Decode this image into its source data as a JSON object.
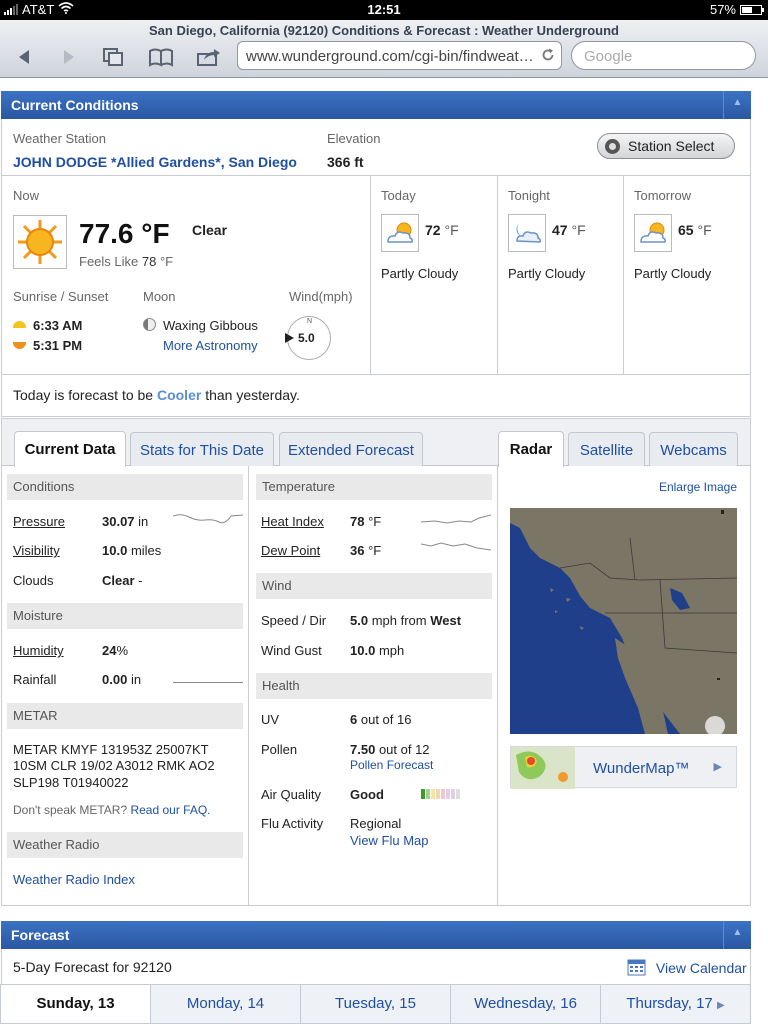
{
  "status": {
    "carrier": "AT&T",
    "time": "12:51",
    "battery": "57%"
  },
  "browser": {
    "title": "San Diego, California (92120) Conditions & Forecast : Weather Underground",
    "url": "www.wunderground.com/cgi-bin/findweat…",
    "search_placeholder": "Google"
  },
  "current": {
    "header": "Current Conditions",
    "station_label": "Weather Station",
    "station_name": "JOHN DODGE *Allied Gardens*, San Diego",
    "elevation_label": "Elevation",
    "elevation": "366 ft",
    "station_select": "Station Select",
    "now_label": "Now",
    "temp": "77.6 °F",
    "condition": "Clear",
    "feels_like_label": "Feels Like",
    "feels_like_value": "78",
    "feels_like_unit": "°F",
    "sun_label": "Sunrise / Sunset",
    "sunrise": "6:33 AM",
    "sunset": "5:31 PM",
    "moon_label": "Moon",
    "moon_phase": "Waxing Gibbous",
    "more_astronomy": "More Astronomy",
    "wind_label": "Wind(mph)",
    "wind_dir": "N",
    "wind_speed": "5.0",
    "periods": [
      {
        "label": "Today",
        "temp": "72",
        "unit": "°F",
        "cond": "Partly Cloudy"
      },
      {
        "label": "Tonight",
        "temp": "47",
        "unit": "°F",
        "cond": "Partly Cloudy"
      },
      {
        "label": "Tomorrow",
        "temp": "65",
        "unit": "°F",
        "cond": "Partly Cloudy"
      }
    ],
    "forecast_text_a": "Today is forecast to be",
    "forecast_text_word": "Cooler",
    "forecast_text_b": "than yesterday."
  },
  "tabs_left": [
    "Current Data",
    "Stats for This Date",
    "Extended Forecast"
  ],
  "tabs_right": [
    "Radar",
    "Satellite",
    "Webcams"
  ],
  "col1": {
    "conditions_hdr": "Conditions",
    "pressure_label": "Pressure",
    "pressure_value": "30.07",
    "pressure_unit": "in",
    "visibility_label": "Visibility",
    "visibility_value": "10.0",
    "visibility_unit": "miles",
    "clouds_label": "Clouds",
    "clouds_value": "Clear",
    "clouds_extra": "-",
    "moisture_hdr": "Moisture",
    "humidity_label": "Humidity",
    "humidity_value": "24",
    "humidity_unit": "%",
    "rainfall_label": "Rainfall",
    "rainfall_value": "0.00",
    "rainfall_unit": "in",
    "metar_hdr": "METAR",
    "metar_line1": "METAR KMYF 131953Z 25007KT",
    "metar_line2": "10SM CLR 19/02 A3012 RMK AO2",
    "metar_line3": "SLP198 T01940022",
    "metar_help": "Don't speak METAR?",
    "metar_faq": "Read our FAQ.",
    "radio_hdr": "Weather Radio",
    "radio_link": "Weather Radio Index"
  },
  "col2": {
    "temperature_hdr": "Temperature",
    "heat_label": "Heat Index",
    "heat_value": "78",
    "heat_unit": "°F",
    "dew_label": "Dew Point",
    "dew_value": "36",
    "dew_unit": "°F",
    "wind_hdr": "Wind",
    "speed_label": "Speed / Dir",
    "speed_value": "5.0",
    "speed_unit": "mph from",
    "speed_dir": "West",
    "gust_label": "Wind Gust",
    "gust_value": "10.0",
    "gust_unit": "mph",
    "health_hdr": "Health",
    "uv_label": "UV",
    "uv_value": "6",
    "uv_unit": "out of 16",
    "pollen_label": "Pollen",
    "pollen_value": "7.50",
    "pollen_unit": "out of 12",
    "pollen_link": "Pollen Forecast",
    "air_label": "Air Quality",
    "air_value": "Good",
    "flu_label": "Flu Activity",
    "flu_value": "Regional",
    "flu_link": "View Flu Map"
  },
  "col3": {
    "enlarge": "Enlarge Image",
    "wundermap": "WunderMap™"
  },
  "forecast": {
    "header": "Forecast",
    "subtitle": "5-Day Forecast for 92120",
    "view_calendar": "View Calendar",
    "days": [
      "Sunday, 13",
      "Monday, 14",
      "Tuesday, 15",
      "Wednesday, 16",
      "Thursday, 17"
    ]
  },
  "colors": {
    "brand_blue": "#2f62b5",
    "link": "#1f4fa3",
    "sun": "#f5a623",
    "radar_ocean": "#1f3f8a",
    "radar_land": "#7a7565"
  }
}
